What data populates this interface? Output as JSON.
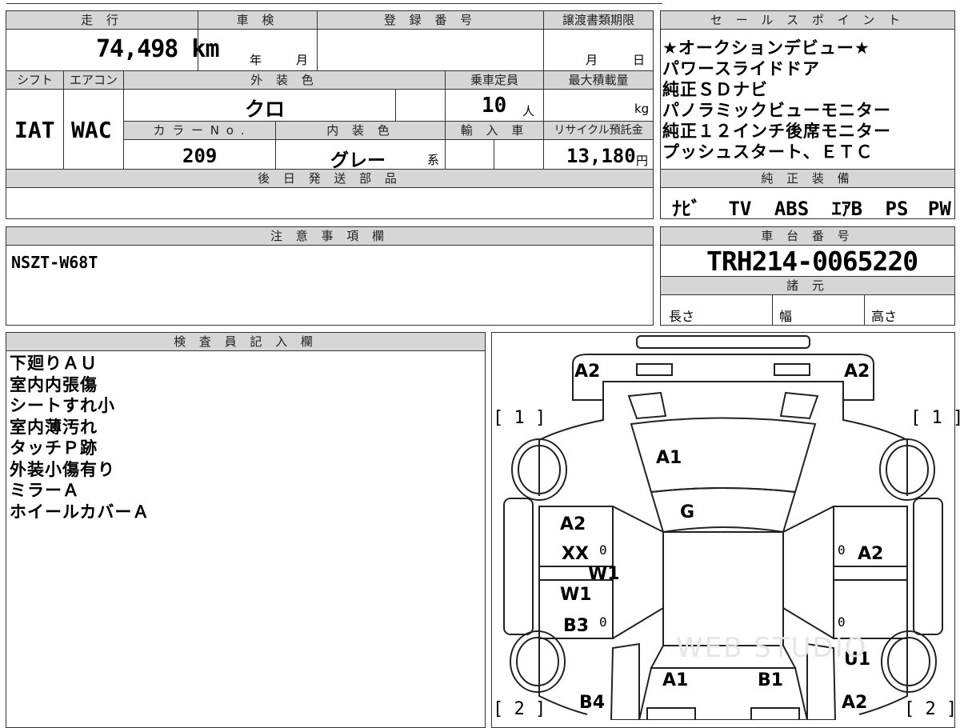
{
  "header": {
    "mileage_label": "走 行",
    "mileage_value": "74,498 km",
    "inspection_label": "車 検",
    "inspection_year": "年",
    "inspection_month": "月",
    "registration_label": "登 録 番 号",
    "transfer_label": "譲渡書類期限",
    "transfer_month": "月",
    "transfer_day": "日",
    "shift_label": "シフト",
    "aircon_label": "エアコン",
    "exterior_color_label": "外 装 色",
    "seating_label": "乗車定員",
    "max_load_label": "最大積載量",
    "shift_value": "IAT",
    "aircon_value": "WAC",
    "exterior_color_value": "クロ",
    "seating_value": "10",
    "seating_unit": "人",
    "max_load_unit": "kg",
    "color_no_label": "カ ラ ー N o .",
    "interior_color_label": "内 装 色",
    "import_label": "輸 入 車",
    "recycle_label": "リサイクル預託金",
    "color_no_value": "209",
    "interior_color_value": "グレー",
    "interior_color_suffix": "系",
    "recycle_value": "13,180",
    "recycle_unit": "円",
    "later_parts_label": "後 日 発 送 部 品"
  },
  "sales_points": {
    "label": "セ ー ル ス ポ イ ン ト",
    "items": [
      "★オークションデビュー★",
      "パワースライドドア",
      "純正ＳＤナビ",
      "パノラミックビューモニター",
      "純正１２インチ後席モニター",
      "プッシュスタート、ＥＴＣ"
    ]
  },
  "equipment": {
    "label": "純 正 装 備",
    "items": [
      "ﾅﾋﾞ",
      "TV",
      "ABS",
      "ｴｱB",
      "PS",
      "PW"
    ]
  },
  "notes": {
    "label": "注 意 事 項 欄",
    "text": "NSZT-W68T"
  },
  "chassis": {
    "label": "車 台 番 号",
    "value": "TRH214-0065220",
    "specs_label": "諸 元",
    "length_label": "長さ",
    "width_label": "幅",
    "height_label": "高さ"
  },
  "inspector": {
    "label": "検 査 員 記 入 欄",
    "lines": [
      "下廻りＡＵ",
      "室内内張傷",
      "シートすれ小",
      "室内薄汚れ",
      "タッチＰ跡",
      "外装小傷有り",
      "ミラーＡ",
      "ホイールカバーＡ"
    ]
  },
  "diagram": {
    "marks": {
      "rear_left": "A2",
      "rear_right": "A2",
      "tag_1_left": "[ 1 ]",
      "tag_1_right": "[ 1 ]",
      "tag_2_left": "[ 2 ]",
      "tag_2_right": "[ 2 ]",
      "rear_window": "A1",
      "roof_rear": "G",
      "left_side_1": "A2",
      "left_side_2": "XX",
      "left_side_3": "W1",
      "left_side_4": "W1",
      "left_side_5": "B3",
      "right_side_1": "A2",
      "right_u1": "U1",
      "front_left": "A1",
      "front_right": "B1",
      "front_left_fender": "B4",
      "front_right_fender": "A2",
      "zero_1": "0",
      "zero_2": "0",
      "zero_3": "0",
      "zero_4": "0"
    },
    "watermark": "WEB STUDIO"
  }
}
